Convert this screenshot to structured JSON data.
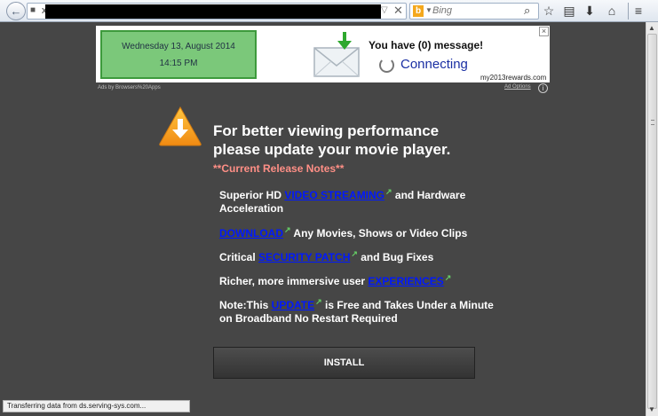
{
  "browser": {
    "url_visible_char": "x",
    "search_placeholder": "Bing",
    "search_engine_icon": "b",
    "status_text": "Transferring data from ds.serving-sys.com..."
  },
  "ad": {
    "date": "Wednesday 13, August 2014",
    "time": "14:15 PM",
    "message": "You have (0) message!",
    "connecting": "Connecting",
    "domain": "my2013rewards.com",
    "close": "×",
    "ads_by": "Ads by Browsers%20Apps",
    "ad_options": "Ad Options",
    "info": "i"
  },
  "main": {
    "headline_line1": "For better viewing performance",
    "headline_line2": "please update your movie player.",
    "release_notes": "**Current Release Notes**",
    "item1_prefix": "Superior HD ",
    "item1_link": "VIDEO STREAMING",
    "item1_suffix": " and Hardware Acceleration",
    "item2_link": "DOWNLOAD",
    "item2_suffix": " Any Movies, Shows or Video Clips",
    "item3_prefix": "Critical ",
    "item3_link": "SECURITY PATCH",
    "item3_suffix": " and Bug Fixes",
    "item4_prefix": "Richer, more immersive user ",
    "item4_link": "EXPERIENCES",
    "item5_prefix": "Note:This ",
    "item5_link": "UPDATE",
    "item5_suffix": " is Free and Takes Under a Minute on Broadband No Restart Required",
    "install_label": "INSTALL"
  },
  "colors": {
    "background": "#464646",
    "link": "#0019ff",
    "notes": "#ff8f86",
    "ad_green": "#7bc87a",
    "warning_orange": "#f5a623"
  },
  "icons": [
    "back-arrow-icon",
    "page-icon",
    "dropdown-icon",
    "close-icon",
    "bing-icon",
    "search-icon",
    "star-icon",
    "clipboard-icon",
    "download-icon",
    "home-icon",
    "menu-icon",
    "mail-icon",
    "spinner-icon",
    "warning-download-icon",
    "external-link-icon",
    "info-icon"
  ]
}
